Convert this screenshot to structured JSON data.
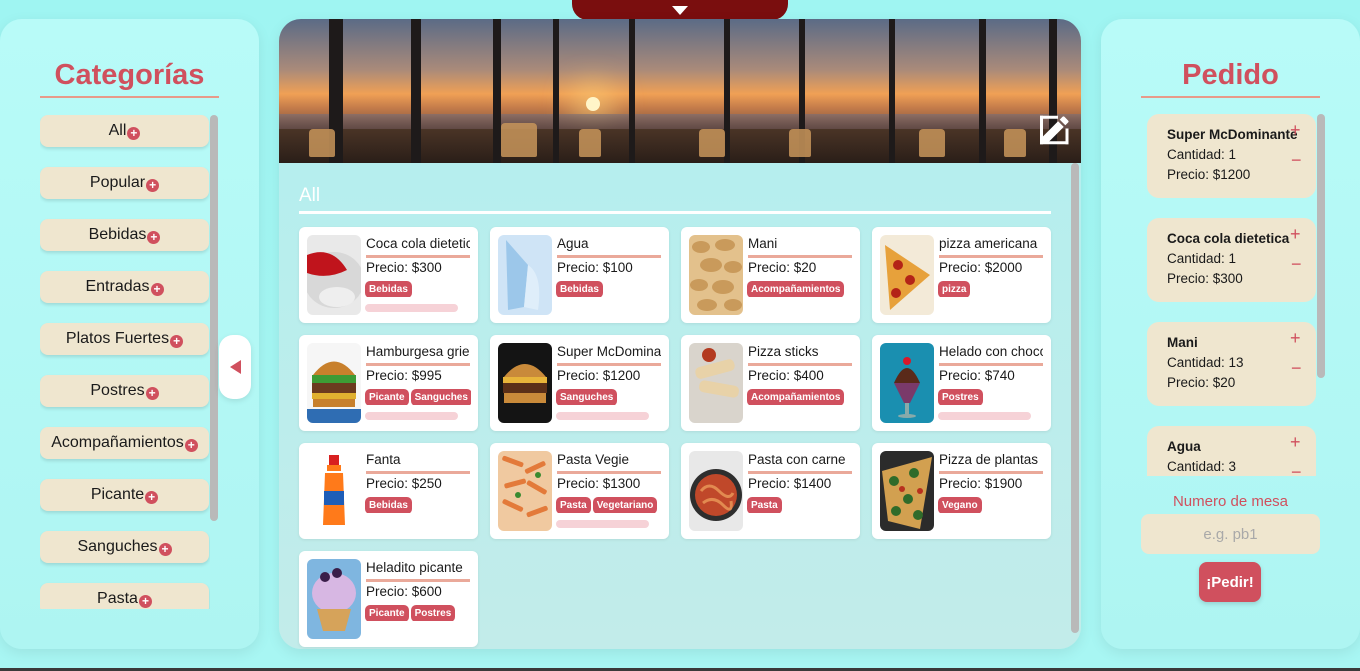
{
  "categories_panel": {
    "title": "Categorías",
    "items": [
      {
        "label": "All"
      },
      {
        "label": "Popular"
      },
      {
        "label": "Bebidas"
      },
      {
        "label": "Entradas"
      },
      {
        "label": "Platos Fuertes"
      },
      {
        "label": "Postres"
      },
      {
        "label": "Acompañamientos"
      },
      {
        "label": "Picante"
      },
      {
        "label": "Sanguches"
      },
      {
        "label": "Pasta"
      }
    ]
  },
  "icons": {
    "add": "plus-circle-icon",
    "prev": "triangle-left-icon",
    "next": "triangle-right-icon",
    "toggle": "triangle-down-icon",
    "edit": "edit-pencil-icon"
  },
  "colors": {
    "accent": "#d0505e",
    "background": "#a8f6f3",
    "tab": "#7a0e0e",
    "chip_bg": "#efe6cf"
  },
  "menu": {
    "section_title": "All",
    "products": [
      {
        "name": "Coca cola dietetica",
        "price": "Precio: $300",
        "tags": [
          "Bebidas"
        ],
        "stock_bar": true,
        "thumb": "coke"
      },
      {
        "name": "Agua",
        "price": "Precio: $100",
        "tags": [
          "Bebidas"
        ],
        "stock_bar": false,
        "thumb": "water"
      },
      {
        "name": "Mani",
        "price": "Precio: $20",
        "tags": [
          "Acompañamientos"
        ],
        "stock_bar": false,
        "thumb": "peanut"
      },
      {
        "name": "pizza americana",
        "price": "Precio: $2000",
        "tags": [
          "pizza"
        ],
        "stock_bar": false,
        "thumb": "pizza"
      },
      {
        "name": "Hamburgesa griega",
        "price": "Precio: $995",
        "tags": [
          "Picante",
          "Sanguches"
        ],
        "stock_bar": true,
        "thumb": "burger"
      },
      {
        "name": "Super McDominante",
        "price": "Precio: $1200",
        "tags": [
          "Sanguches"
        ],
        "stock_bar": true,
        "thumb": "burger2"
      },
      {
        "name": "Pizza sticks",
        "price": "Precio: $400",
        "tags": [
          "Acompañamientos"
        ],
        "stock_bar": false,
        "thumb": "sticks"
      },
      {
        "name": "Helado con chocolate",
        "price": "Precio: $740",
        "tags": [
          "Postres"
        ],
        "stock_bar": true,
        "thumb": "sundae"
      },
      {
        "name": "Fanta",
        "price": "Precio: $250",
        "tags": [
          "Bebidas"
        ],
        "stock_bar": false,
        "thumb": "fanta"
      },
      {
        "name": "Pasta Vegie",
        "price": "Precio: $1300",
        "tags": [
          "Pasta",
          "Vegetariano"
        ],
        "stock_bar": true,
        "thumb": "pasta"
      },
      {
        "name": "Pasta con carne",
        "price": "Precio: $1400",
        "tags": [
          "Pasta"
        ],
        "stock_bar": false,
        "thumb": "pasta2"
      },
      {
        "name": "Pizza de plantas",
        "price": "Precio: $1900",
        "tags": [
          "Vegano"
        ],
        "stock_bar": false,
        "thumb": "pizza2"
      },
      {
        "name": "Heladito picante",
        "price": "Precio: $600",
        "tags": [
          "Picante",
          "Postres"
        ],
        "stock_bar": false,
        "thumb": "icecream"
      }
    ]
  },
  "order_panel": {
    "title": "Pedido",
    "items": [
      {
        "name": "Super McDominante",
        "qty": "Cantidad: 1",
        "price": "Precio: $1200"
      },
      {
        "name": "Coca cola dietetica",
        "qty": "Cantidad: 1",
        "price": "Precio: $300"
      },
      {
        "name": "Mani",
        "qty": "Cantidad: 13",
        "price": "Precio: $20"
      },
      {
        "name": "Agua",
        "qty": "Cantidad: 3",
        "price": ""
      }
    ],
    "plus_symbol": "+",
    "minus_symbol": "−",
    "table_label": "Numero de mesa",
    "table_placeholder": "e.g. pb1",
    "table_value": "",
    "submit_label": "¡Pedir!"
  }
}
